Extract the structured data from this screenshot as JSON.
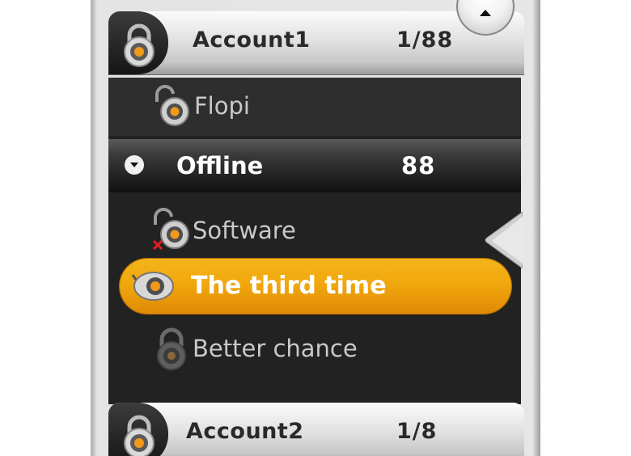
{
  "colors": {
    "accent": "#f1a80d",
    "list_background": "#222222",
    "account_bar": "#e2e2e2"
  },
  "accounts": [
    {
      "name": "Account1",
      "count": "1/88",
      "icon": "padlock-account-icon"
    },
    {
      "name": "Account2",
      "count": "1/8",
      "icon": "padlock-account-icon"
    }
  ],
  "contacts_top": [
    {
      "name": "Flopi",
      "icon": "padlock-open-icon"
    }
  ],
  "group": {
    "name": "Offline",
    "count": "88",
    "icon": "chevron-down-icon"
  },
  "contacts_offline": [
    {
      "name": "Software",
      "icon": "padlock-open-blocked-icon"
    },
    {
      "name": "The third time",
      "icon": "padlock-open-icon",
      "selected": true
    },
    {
      "name": "Better chance",
      "icon": "padlock-closed-icon"
    }
  ],
  "controls": {
    "collapse_icon": "chevron-up-icon",
    "scroll_pointer_icon": "pointer-arrow-icon"
  }
}
